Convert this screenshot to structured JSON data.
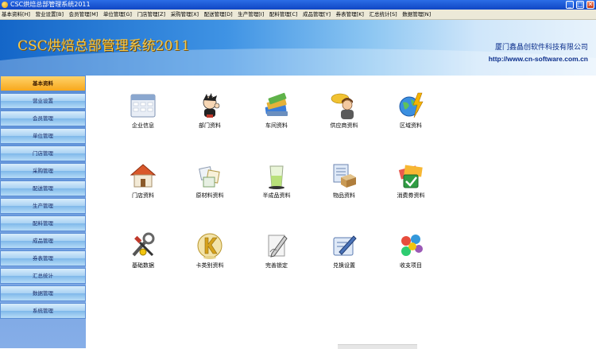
{
  "window": {
    "title": "CSC烘焙总部管理系统2011",
    "buttons": [
      "_",
      "□",
      "✕"
    ]
  },
  "menu": [
    "基本资料[H]",
    "营业设置[B]",
    "会员管理[M]",
    "单位管理[G]",
    "门店管理[Z]",
    "采购管理[X]",
    "配送管理[D]",
    "生产管理[I]",
    "配料管理[C]",
    "成品管理[Y]",
    "券表管理[K]",
    "汇总统计[S]",
    "数据管理[N]"
  ],
  "banner": {
    "title": "CSC烘焙总部管理系统2011",
    "company": "厦门鑫晶创软件科技有限公司",
    "url": "http://www.cn-software.com.cn"
  },
  "sidebar": [
    "基本资料",
    "营业设置",
    "会员管理",
    "单位管理",
    "门店管理",
    "采购管理",
    "配送管理",
    "生产管理",
    "配料管理",
    "成品管理",
    "券表管理",
    "汇总统计",
    "数据管理",
    "系统管理"
  ],
  "active_sidebar": "基本资料",
  "tiles": [
    "企业信息",
    "部门资料",
    "车间资料",
    "供应商资料",
    "区域资料",
    "门店资料",
    "原材料资料",
    "半成品资料",
    "物品资料",
    "消费券资料",
    "基础数据",
    "卡类别资料",
    "完善锁定",
    "兑换设置",
    "收支项目"
  ]
}
